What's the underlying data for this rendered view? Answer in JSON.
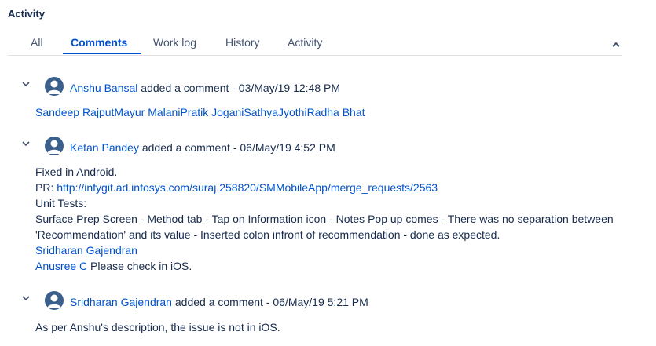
{
  "section_title": "Activity",
  "tabs": [
    {
      "label": "All"
    },
    {
      "label": "Comments"
    },
    {
      "label": "Work log"
    },
    {
      "label": "History"
    },
    {
      "label": "Activity"
    }
  ],
  "active_tab": "Comments",
  "comments": [
    {
      "author": "Anshu Bansal",
      "action": "added a comment - 03/May/19 12:48 PM",
      "mentions": [
        "Sandeep Rajput",
        "Mayur Malani",
        "Pratik Jogani",
        "Sathya",
        "Jyothi",
        "Radha Bhat"
      ]
    },
    {
      "author": "Ketan Pandey",
      "action": "added a comment - 06/May/19 4:52 PM",
      "line1": "Fixed in Android.",
      "pr_label": "PR:",
      "pr_url": "http://infygit.ad.infosys.com/suraj.258820/SMMobileApp/merge_requests/2563",
      "line3": "Unit Tests:",
      "line4": "Surface Prep Screen - Method tab - Tap on Information icon - Notes Pop up comes - There was no separation between",
      "line5": "'Recommendation' and its value - Inserted colon infront of recommendation - done as expected.",
      "mention1": "Sridharan Gajendran",
      "mention2": "Anusree C",
      "line7_rest": " Please check in iOS."
    },
    {
      "author": "Sridharan Gajendran",
      "action": "added a comment - 06/May/19 5:21 PM",
      "line1": "As per Anshu's description, the issue is not in iOS."
    }
  ]
}
